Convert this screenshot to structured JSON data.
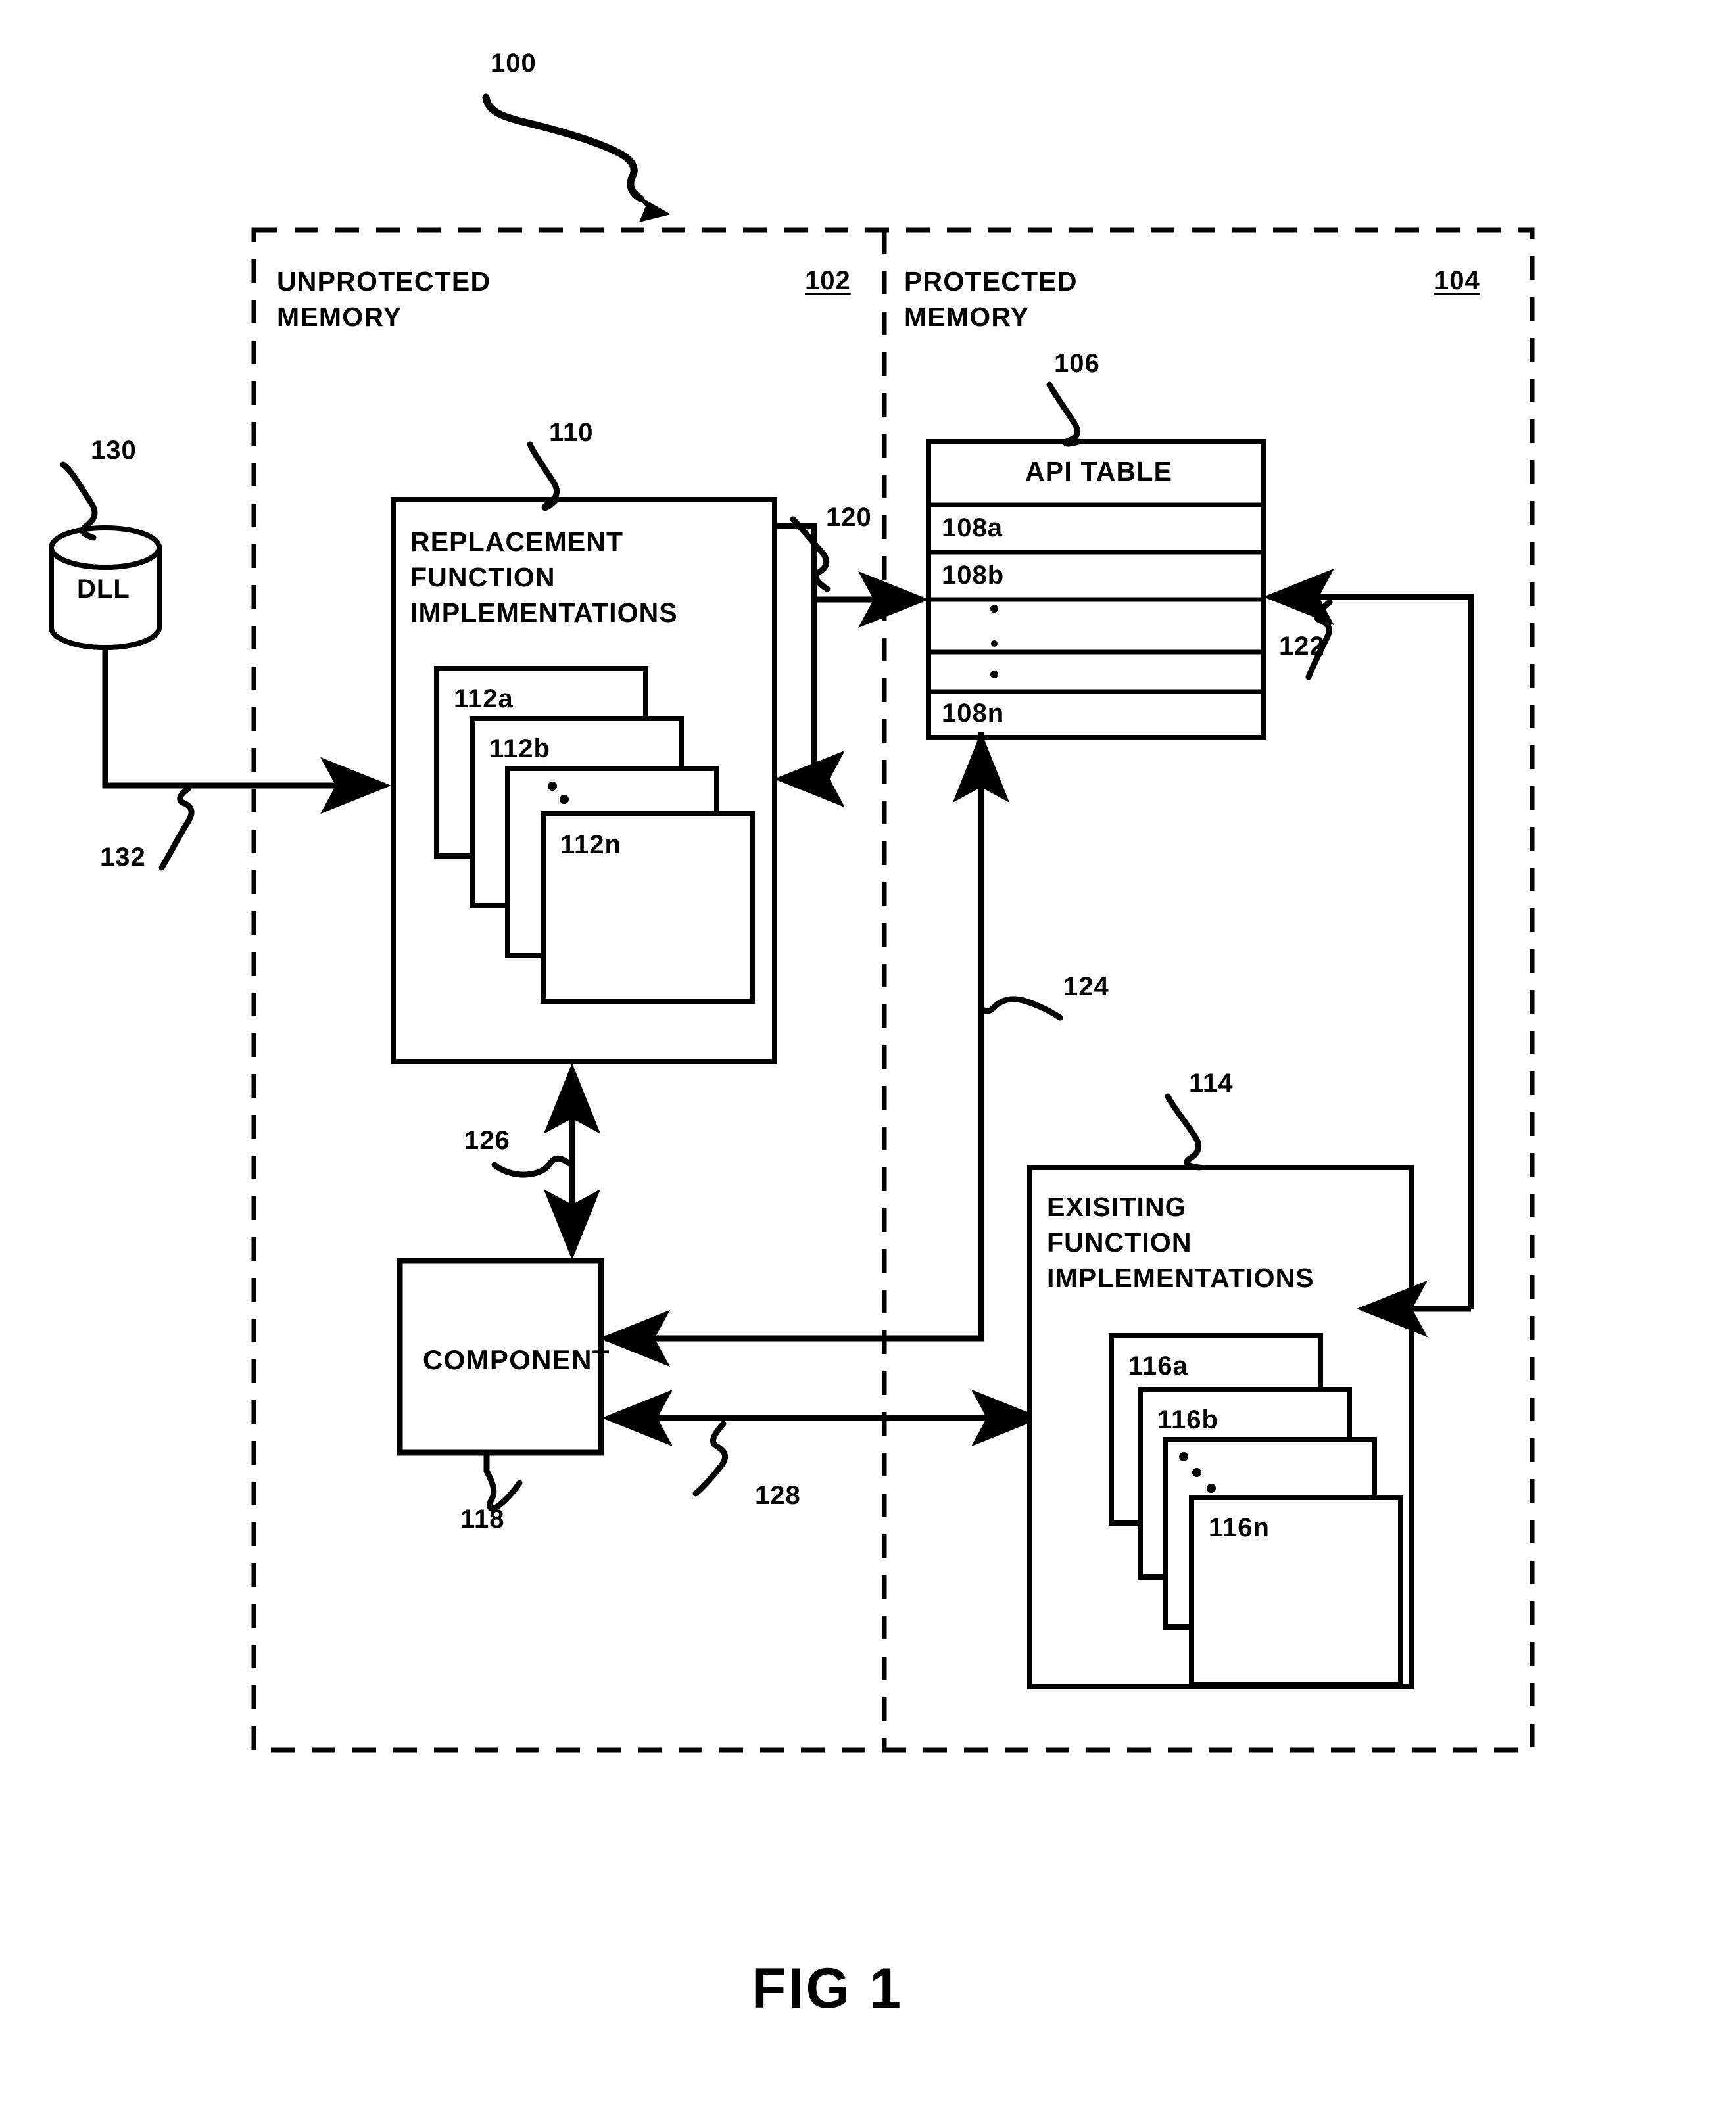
{
  "figure": {
    "caption": "FIG 1",
    "system_ref": "100"
  },
  "zones": [
    {
      "name": "unprotected",
      "title_line1": "UNPROTECTED",
      "title_line2": "MEMORY",
      "ref": "102"
    },
    {
      "name": "protected",
      "title_line1": "PROTECTED",
      "title_line2": "MEMORY",
      "ref": "104"
    }
  ],
  "dll": {
    "label": "DLL",
    "ref": "130",
    "flow_ref": "132"
  },
  "replacement_box": {
    "title_line1": "REPLACEMENT",
    "title_line2": "FUNCTION",
    "title_line3": "IMPLEMENTATIONS",
    "ref": "110",
    "cards": [
      "112a",
      "112b",
      "",
      "112n"
    ]
  },
  "api_table": {
    "header": "API TABLE",
    "ref": "106",
    "rows": [
      "108a",
      "108b",
      "",
      "",
      "108n"
    ]
  },
  "existing_box": {
    "title_line1": "EXISITING",
    "title_line2": "FUNCTION",
    "title_line3": "IMPLEMENTATIONS",
    "ref": "114",
    "cards": [
      "116a",
      "116b",
      "",
      "116n"
    ]
  },
  "component": {
    "label": "COMPONENT",
    "ref": "118"
  },
  "flows": {
    "replacement_to_api": "120",
    "existing_to_api": "122",
    "api_to_component": "124",
    "component_to_replacement": "126",
    "component_to_existing": "128"
  },
  "colors": {
    "ink": "#000000",
    "paper": "#ffffff"
  }
}
